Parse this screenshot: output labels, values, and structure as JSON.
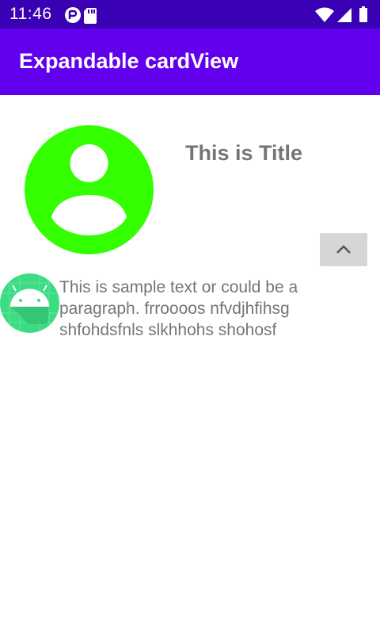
{
  "status_bar": {
    "time": "11:46",
    "icons_left": [
      "sync-icon",
      "sd-card-icon"
    ],
    "icons_right": [
      "wifi-icon",
      "cell-signal-icon",
      "battery-icon"
    ]
  },
  "app_bar": {
    "title": "Expandable cardView"
  },
  "card": {
    "title": "This is Title",
    "body": "This is sample text or could be a paragraph. frroooos nfvdjhfihsg shfohdsfnls slkhhohs shohosf",
    "expand_icon": "chevron-up-icon",
    "avatar_icon": "account-circle-icon",
    "thumbnail_icon": "android-icon"
  },
  "colors": {
    "status_bar": "#3a00b4",
    "app_bar": "#6200ee",
    "avatar": "#33ff00",
    "android": "#3ddc84",
    "text_gray": "#757575",
    "button_gray": "#d6d6d6"
  }
}
